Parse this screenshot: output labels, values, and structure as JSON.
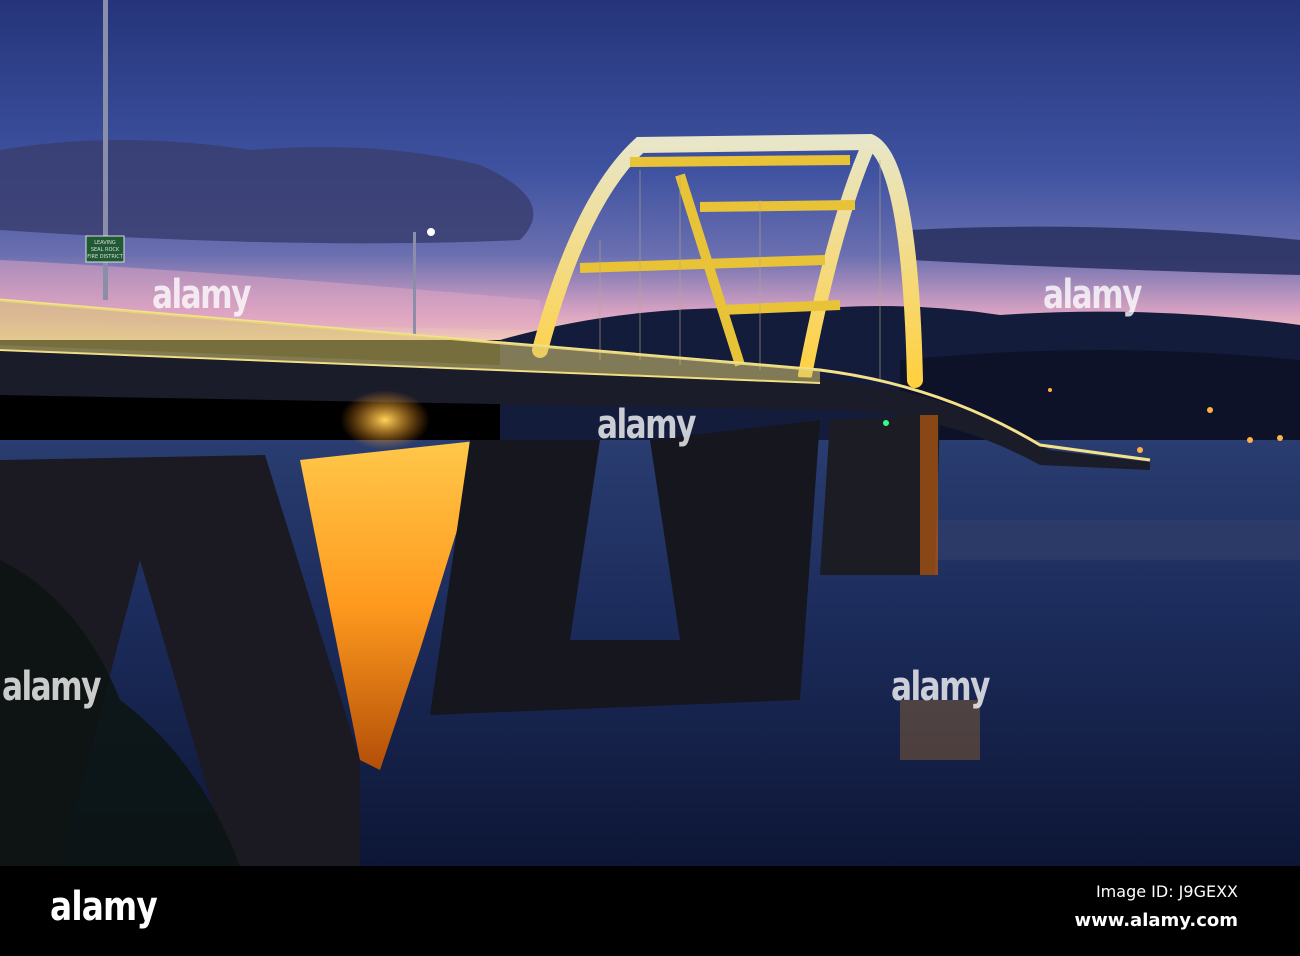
{
  "photo": {
    "subject": "arch-bridge-at-dusk",
    "sign": {
      "line1": "LEAVING",
      "line2": "SEAL ROCK",
      "line3": "FIRE DISTRICT"
    },
    "colors": {
      "sky_top": "#26367a",
      "sky_mid": "#4a5aa6",
      "horizon": "#e7a9c0",
      "arch": "#f2d23a",
      "glow": "#ff9a1e",
      "water": "#16244f"
    }
  },
  "watermark": {
    "text": "alamy"
  },
  "footer": {
    "logo": "alamy",
    "image_id": "Image ID: J9GEXX",
    "website": "www.alamy.com"
  }
}
